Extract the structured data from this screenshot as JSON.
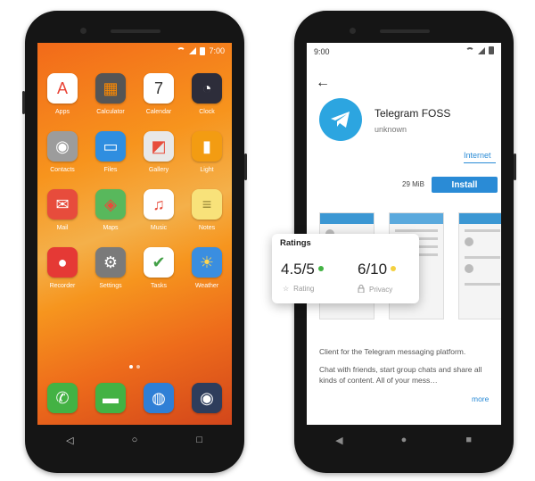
{
  "colors": {
    "accent": "#2a8bd6",
    "rating_dot": "#43b244",
    "privacy_dot": "#f4d03f",
    "telegram": "#2ca5e0"
  },
  "left_phone": {
    "status_time": "7:00",
    "apps": [
      {
        "label": "Apps",
        "icon": "apps-icon",
        "glyph": "A",
        "color": "#ffffff",
        "fg": "#e94235"
      },
      {
        "label": "Calculator",
        "icon": "calculator-icon",
        "glyph": "▦",
        "color": "#555555",
        "fg": "#ff8a00"
      },
      {
        "label": "Calendar",
        "icon": "calendar-icon",
        "glyph": "7",
        "color": "#ffffff",
        "fg": "#333333"
      },
      {
        "label": "Clock",
        "icon": "clock-icon",
        "glyph": "◔",
        "color": "#2d2d3a",
        "fg": "#ffffff"
      },
      {
        "label": "Contacts",
        "icon": "contacts-icon",
        "glyph": "◉",
        "color": "#9c9c9c",
        "fg": "#ffffff"
      },
      {
        "label": "Files",
        "icon": "files-icon",
        "glyph": "▭",
        "color": "#2f8ee0",
        "fg": "#ffffff"
      },
      {
        "label": "Gallery",
        "icon": "gallery-icon",
        "glyph": "◩",
        "color": "#e8e8e8",
        "fg": "#e74c3c"
      },
      {
        "label": "Light",
        "icon": "flashlight-icon",
        "glyph": "▮",
        "color": "#f39c12",
        "fg": "#ffffff"
      },
      {
        "label": "Mail",
        "icon": "mail-icon",
        "glyph": "✉",
        "color": "#e74c3c",
        "fg": "#ffffff"
      },
      {
        "label": "Maps",
        "icon": "maps-icon",
        "glyph": "◈",
        "color": "#58b85c",
        "fg": "#e74c3c"
      },
      {
        "label": "Music",
        "icon": "music-icon",
        "glyph": "♫",
        "color": "#ffffff",
        "fg": "#e74c3c"
      },
      {
        "label": "Notes",
        "icon": "notes-icon",
        "glyph": "≡",
        "color": "#f8e27a",
        "fg": "#9a8a3a"
      },
      {
        "label": "Recorder",
        "icon": "microphone-icon",
        "glyph": "●",
        "color": "#e53935",
        "fg": "#ffffff"
      },
      {
        "label": "Settings",
        "icon": "gear-icon",
        "glyph": "⚙",
        "color": "#7a7a7a",
        "fg": "#ffffff"
      },
      {
        "label": "Tasks",
        "icon": "tasks-icon",
        "glyph": "✔",
        "color": "#ffffff",
        "fg": "#43a047"
      },
      {
        "label": "Weather",
        "icon": "weather-icon",
        "glyph": "☀",
        "color": "#3a8ee0",
        "fg": "#ffd54f"
      }
    ],
    "dock": [
      {
        "icon": "phone-icon",
        "glyph": "✆",
        "color": "#43b244",
        "fg": "#ffffff"
      },
      {
        "icon": "messages-icon",
        "glyph": "▬",
        "color": "#43b244",
        "fg": "#ffffff"
      },
      {
        "icon": "browser-icon",
        "glyph": "◍",
        "color": "#2f7fd6",
        "fg": "#ffffff"
      },
      {
        "icon": "camera-icon",
        "glyph": "◉",
        "color": "#2e3d5c",
        "fg": "#ffffff"
      }
    ],
    "nav": {
      "back": "◁",
      "home": "○",
      "recents": "□"
    }
  },
  "right_phone": {
    "status_time": "9:00",
    "app_name": "Telegram FOSS",
    "author": "unknown",
    "tag": "Internet",
    "size": "29 MiB",
    "install_label": "Install",
    "description_1": "Client for the Telegram messaging platform.",
    "description_2": "Chat with friends, start group chats and share all kinds of content. All of your mess…",
    "more_label": "more",
    "nav": {
      "back": "◀",
      "home": "●",
      "recents": "■"
    }
  },
  "ratings": {
    "title": "Ratings",
    "rating_value": "4.5/5",
    "rating_label": "Rating",
    "privacy_value": "6/10",
    "privacy_label": "Privacy"
  }
}
